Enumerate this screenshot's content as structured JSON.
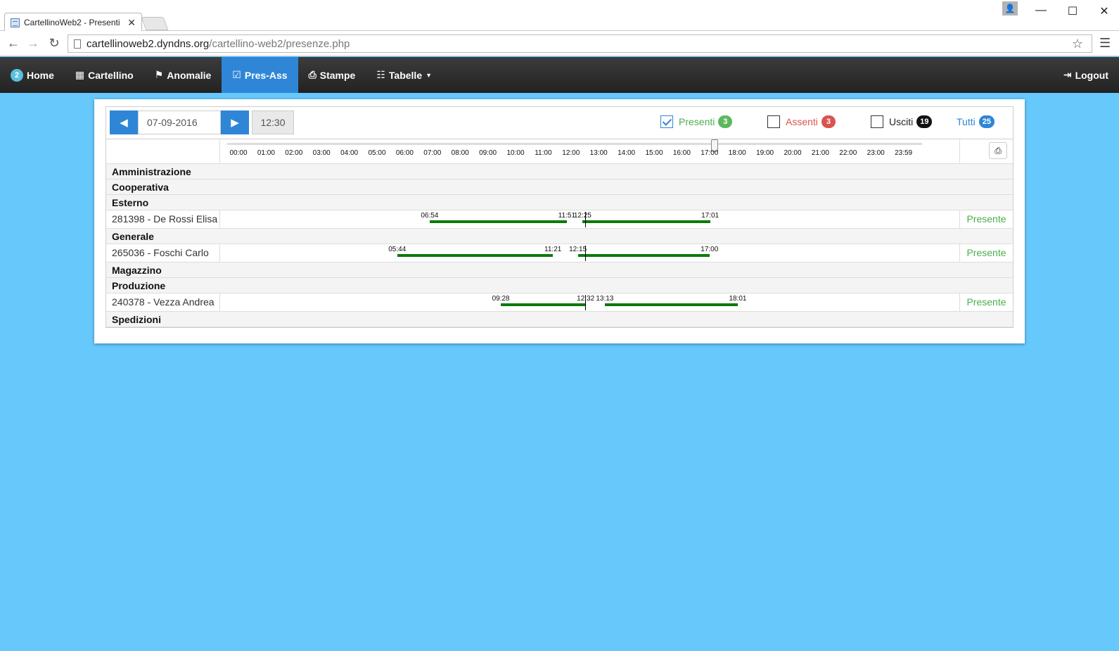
{
  "browser": {
    "tab_title": "CartellinoWeb2 - Presenti",
    "url_host": "cartellinoweb2.dyndns.org",
    "url_path": "/cartellino-web2/presenze.php"
  },
  "nav": {
    "home_badge": "2",
    "home": "Home",
    "cartellino": "Cartellino",
    "anomalie": "Anomalie",
    "pres_ass": "Pres-Ass",
    "stampe": "Stampe",
    "tabelle": "Tabelle",
    "logout": "Logout"
  },
  "controls": {
    "date": "07-09-2016",
    "time": "12:30"
  },
  "filters": {
    "presenti": {
      "label": "Presenti",
      "count": "3",
      "checked": true
    },
    "assenti": {
      "label": "Assenti",
      "count": "3",
      "checked": false
    },
    "usciti": {
      "label": "Usciti",
      "count": "19",
      "checked": false
    },
    "tutti": {
      "label": "Tutti",
      "count": "25"
    }
  },
  "timeline": {
    "ticks": [
      "00:00",
      "01:00",
      "02:00",
      "03:00",
      "04:00",
      "05:00",
      "06:00",
      "07:00",
      "08:00",
      "09:00",
      "10:00",
      "11:00",
      "12:00",
      "13:00",
      "14:00",
      "15:00",
      "16:00",
      "17:00",
      "18:00",
      "19:00",
      "20:00",
      "21:00",
      "22:00",
      "23:00",
      "23:59"
    ],
    "current_time_hours": 12.5
  },
  "groups": [
    {
      "name": "Amministrazione",
      "employees": []
    },
    {
      "name": "Cooperativa",
      "employees": []
    },
    {
      "name": "Esterno",
      "employees": [
        {
          "label": "281398 - De Rossi Elisa",
          "status": "Presente",
          "segments": [
            {
              "start": "06:54",
              "end": "11:51",
              "s": 6.9,
              "e": 11.85
            },
            {
              "start": "12:25",
              "end": "17:01",
              "s": 12.42,
              "e": 17.02
            }
          ]
        }
      ]
    },
    {
      "name": "Generale",
      "employees": [
        {
          "label": "265036 - Foschi Carlo",
          "status": "Presente",
          "segments": [
            {
              "start": "05:44",
              "end": "11:21",
              "s": 5.73,
              "e": 11.35
            },
            {
              "start": "12:15",
              "end": "17:00",
              "s": 12.25,
              "e": 17.0
            }
          ]
        }
      ]
    },
    {
      "name": "Magazzino",
      "employees": []
    },
    {
      "name": "Produzione",
      "employees": [
        {
          "label": "240378 - Vezza Andrea",
          "status": "Presente",
          "segments": [
            {
              "start": "09:28",
              "end": "12:32",
              "s": 9.47,
              "e": 12.53
            },
            {
              "start": "13:13",
              "end": "18:01",
              "s": 13.22,
              "e": 18.02
            }
          ]
        }
      ]
    },
    {
      "name": "Spedizioni",
      "employees": []
    }
  ]
}
